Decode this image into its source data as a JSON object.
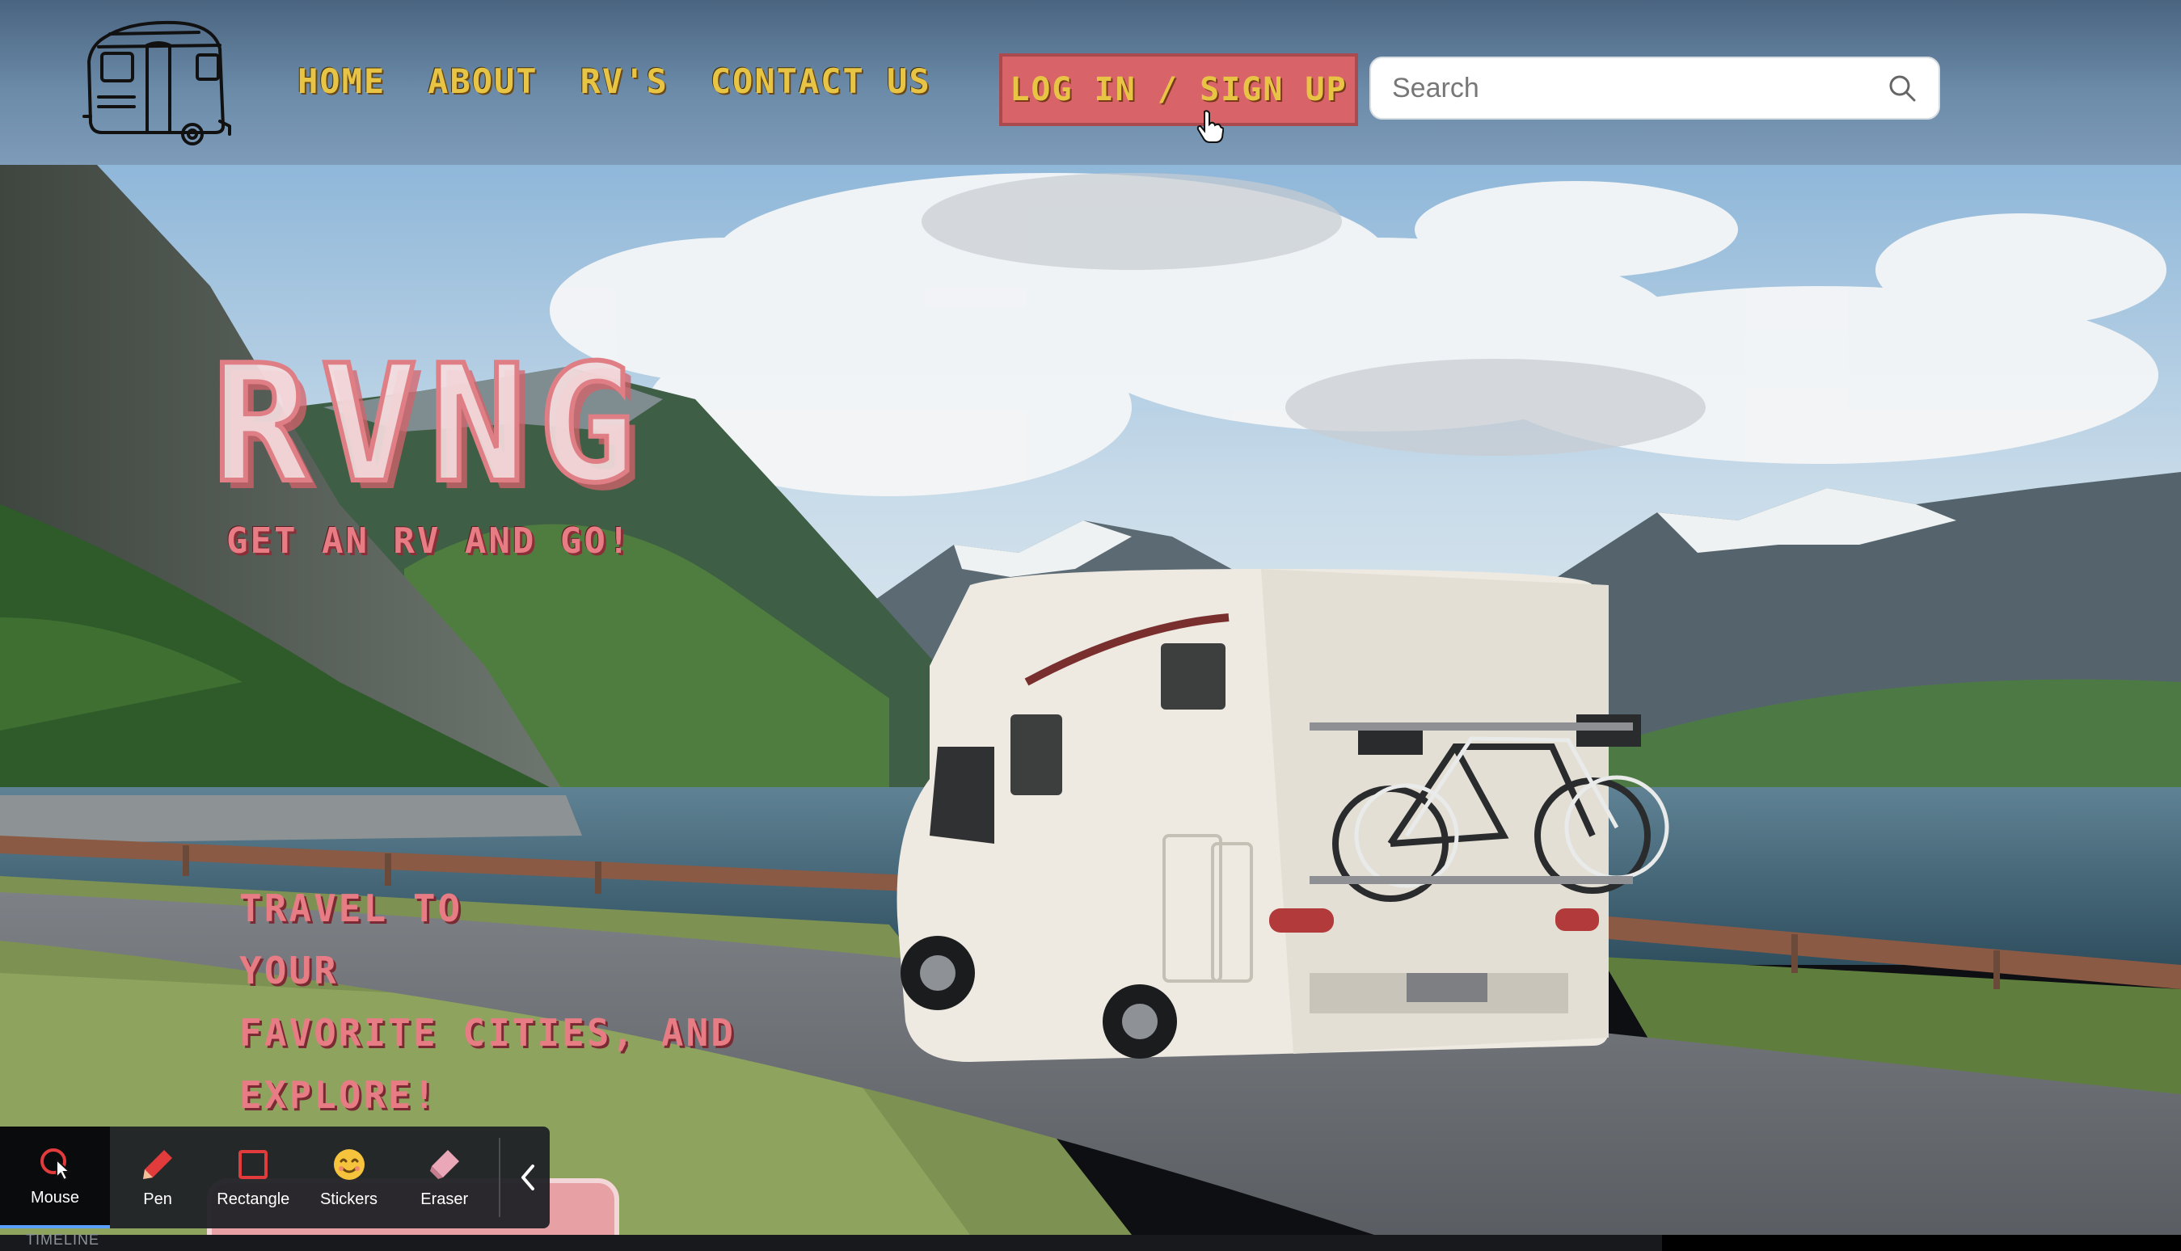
{
  "nav": {
    "links": [
      "HOME",
      "ABOUT",
      "RV'S",
      "CONTACT US"
    ],
    "login_label": "LOG IN / SIGN UP",
    "search_placeholder": "Search"
  },
  "hero": {
    "title": "RVNG",
    "tagline": "GET AN RV AND GO!",
    "travel_lines": [
      "TRAVEL TO",
      "YOUR",
      "FAVORITE CITIES, AND",
      "EXPLORE!"
    ]
  },
  "toolbar": {
    "tools": [
      {
        "label": "Mouse",
        "icon": "mouse-cursor-icon",
        "active": true
      },
      {
        "label": "Pen",
        "icon": "pen-icon",
        "active": false
      },
      {
        "label": "Rectangle",
        "icon": "rectangle-icon",
        "active": false
      },
      {
        "label": "Stickers",
        "icon": "smiley-sticker-icon",
        "active": false
      },
      {
        "label": "Eraser",
        "icon": "eraser-icon",
        "active": false
      }
    ]
  },
  "timeline_label": "TIMELINE",
  "colors": {
    "nav_text": "#e8c445",
    "login_bg": "#d8646a",
    "hero_text": "#e77c84",
    "toolbar_bg": "#202226"
  }
}
